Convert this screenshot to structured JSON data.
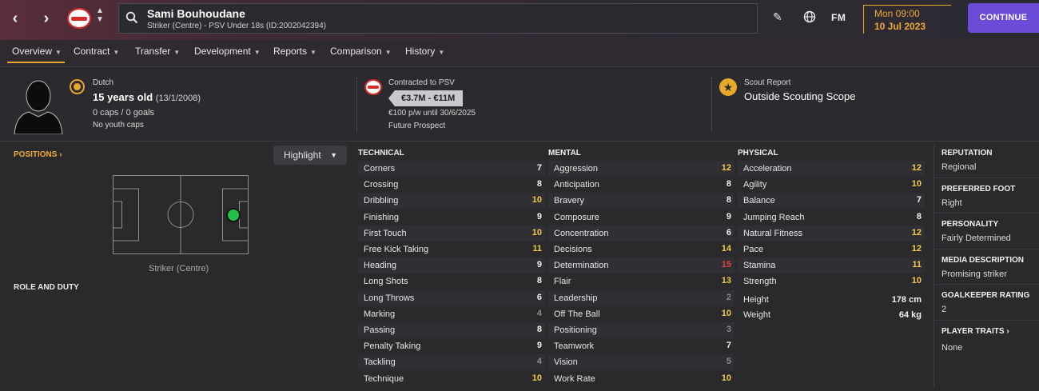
{
  "header": {
    "player_name": "Sami Bouhoudane",
    "player_subtitle": "Striker (Centre) - PSV Under 18s (ID:2002042394)",
    "fm_logo": "FM",
    "date_time": "Mon 09:00",
    "date_day": "10 Jul 2023",
    "continue_label": "CONTINUE",
    "icons": [
      "back-icon",
      "forward-icon",
      "club-logo",
      "search-icon",
      "edit-icon",
      "globe-icon"
    ]
  },
  "tabs": [
    {
      "label": "Overview"
    },
    {
      "label": "Contract"
    },
    {
      "label": "Transfer"
    },
    {
      "label": "Development"
    },
    {
      "label": "Reports"
    },
    {
      "label": "Comparison"
    },
    {
      "label": "History"
    }
  ],
  "info": {
    "nationality": "Dutch",
    "age": "15 years old",
    "dob": "(13/1/2008)",
    "caps": "0 caps / 0 goals",
    "youth_caps": "No youth caps",
    "contract_title": "Contracted to PSV",
    "value": "€3.7M - €11M",
    "wage": "€100 p/w until 30/6/2025",
    "status": "Future Prospect",
    "scout_title": "Scout Report",
    "scout_value": "Outside Scouting Scope"
  },
  "left": {
    "positions_label": "POSITIONS",
    "highlight_label": "Highlight",
    "position_caption": "Striker (Centre)",
    "role_label": "ROLE AND DUTY"
  },
  "attributes": {
    "technical_title": "TECHNICAL",
    "mental_title": "MENTAL",
    "physical_title": "PHYSICAL",
    "technical": [
      {
        "name": "Corners",
        "value": "7"
      },
      {
        "name": "Crossing",
        "value": "8"
      },
      {
        "name": "Dribbling",
        "value": "10"
      },
      {
        "name": "Finishing",
        "value": "9"
      },
      {
        "name": "First Touch",
        "value": "10"
      },
      {
        "name": "Free Kick Taking",
        "value": "11"
      },
      {
        "name": "Heading",
        "value": "9"
      },
      {
        "name": "Long Shots",
        "value": "8"
      },
      {
        "name": "Long Throws",
        "value": "6"
      },
      {
        "name": "Marking",
        "value": "4"
      },
      {
        "name": "Passing",
        "value": "8"
      },
      {
        "name": "Penalty Taking",
        "value": "9"
      },
      {
        "name": "Tackling",
        "value": "4"
      },
      {
        "name": "Technique",
        "value": "10"
      }
    ],
    "mental": [
      {
        "name": "Aggression",
        "value": "12"
      },
      {
        "name": "Anticipation",
        "value": "8"
      },
      {
        "name": "Bravery",
        "value": "8"
      },
      {
        "name": "Composure",
        "value": "9"
      },
      {
        "name": "Concentration",
        "value": "6"
      },
      {
        "name": "Decisions",
        "value": "14"
      },
      {
        "name": "Determination",
        "value": "15"
      },
      {
        "name": "Flair",
        "value": "13"
      },
      {
        "name": "Leadership",
        "value": "2"
      },
      {
        "name": "Off The Ball",
        "value": "10"
      },
      {
        "name": "Positioning",
        "value": "3"
      },
      {
        "name": "Teamwork",
        "value": "7"
      },
      {
        "name": "Vision",
        "value": "5"
      },
      {
        "name": "Work Rate",
        "value": "10"
      }
    ],
    "physical": [
      {
        "name": "Acceleration",
        "value": "12"
      },
      {
        "name": "Agility",
        "value": "10"
      },
      {
        "name": "Balance",
        "value": "7"
      },
      {
        "name": "Jumping Reach",
        "value": "8"
      },
      {
        "name": "Natural Fitness",
        "value": "12"
      },
      {
        "name": "Pace",
        "value": "12"
      },
      {
        "name": "Stamina",
        "value": "11"
      },
      {
        "name": "Strength",
        "value": "10"
      }
    ],
    "height_label": "Height",
    "height_value": "178 cm",
    "weight_label": "Weight",
    "weight_value": "64 kg"
  },
  "right": {
    "reputation_title": "REPUTATION",
    "reputation_value": "Regional",
    "foot_title": "PREFERRED FOOT",
    "foot_value": "Right",
    "personality_title": "PERSONALITY",
    "personality_value": "Fairly Determined",
    "media_title": "MEDIA DESCRIPTION",
    "media_value": "Promising striker",
    "gk_title": "GOALKEEPER RATING",
    "gk_value": "2",
    "traits_title": "PLAYER TRAITS",
    "traits_value": "None"
  },
  "colors": {
    "accent": "#e6a92d",
    "continue": "#6a4cd8",
    "attr_good": "#f2c94c",
    "attr_poor": "#8a8a8e",
    "attr_top": "#e0413a",
    "position_dot": "#22c04a"
  }
}
